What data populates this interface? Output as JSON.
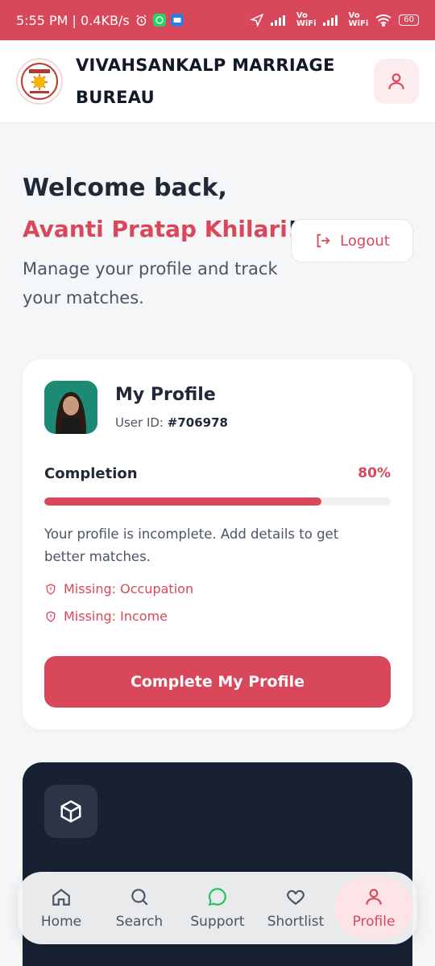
{
  "status_bar": {
    "time_speed": "5:55 PM | 0.4KB/s",
    "vo_wifi_1": "Vo\nWiFi",
    "vo_wifi_2": "Vo\nWiFi",
    "battery": "60"
  },
  "header": {
    "brand_name": "VIVAHSANKALP MARRIAGE BUREAU"
  },
  "welcome": {
    "greeting": "Welcome back,",
    "user_name": "Avanti Pratap Khilari",
    "exclaim": "!",
    "subtitle": "Manage your profile and track your matches.",
    "logout_label": "Logout"
  },
  "profile_card": {
    "title": "My Profile",
    "user_id_label": "User ID:",
    "user_id_value": "#706978",
    "completion_label": "Completion",
    "completion_value": "80%",
    "completion_fraction": 0.8,
    "incomplete_message": "Your profile is incomplete. Add details to get better matches.",
    "missing": [
      "Missing: Occupation",
      "Missing: Income"
    ],
    "cta_label": "Complete My Profile"
  },
  "bottom_nav": {
    "items": [
      {
        "label": "Home",
        "icon": "home-icon"
      },
      {
        "label": "Search",
        "icon": "search-icon"
      },
      {
        "label": "Support",
        "icon": "chat-bubble-icon"
      },
      {
        "label": "Shortlist",
        "icon": "heart-icon"
      },
      {
        "label": "Profile",
        "icon": "user-icon",
        "active": true
      }
    ]
  },
  "colors": {
    "brand": "#d9475a",
    "dark_card": "#172133",
    "support_icon": "#22c55e"
  }
}
